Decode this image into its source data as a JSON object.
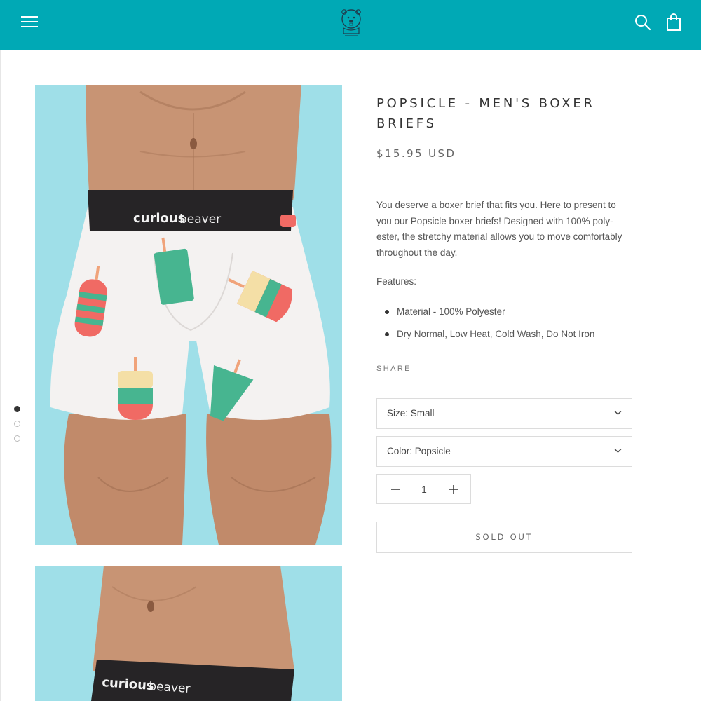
{
  "header": {
    "menu_icon": "hamburger-icon",
    "logo_icon": "beaver-logo",
    "search_icon": "search-icon",
    "cart_icon": "shopping-bag-icon",
    "bar_color": "#00a9b5"
  },
  "gallery": {
    "dots": [
      {
        "state": "active"
      },
      {
        "state": "inactive"
      },
      {
        "state": "inactive"
      }
    ],
    "waistband_text_bold": "curious",
    "waistband_text_light": "beaver",
    "background_color": "#9fdfe8"
  },
  "product": {
    "title": "POPSICLE - MEN'S BOXER BRIEFS",
    "price": "$15.95 USD",
    "description": "You deserve a boxer brief that fits you. Here to present to you our Popsicle boxer briefs! Designed with 100% poly-ester, the stretchy material allows you to move comfortably throughout the day.",
    "features_label": "Features:",
    "features": [
      "Material - 100% Polyester",
      "Dry Normal, Low Heat, Cold Wash, Do Not Iron"
    ],
    "share_label": "SHARE"
  },
  "options": {
    "size_label": "Size: Small",
    "color_label": "Color: Popsicle"
  },
  "quantity": {
    "value": "1"
  },
  "actions": {
    "sold_out_label": "SOLD OUT"
  }
}
